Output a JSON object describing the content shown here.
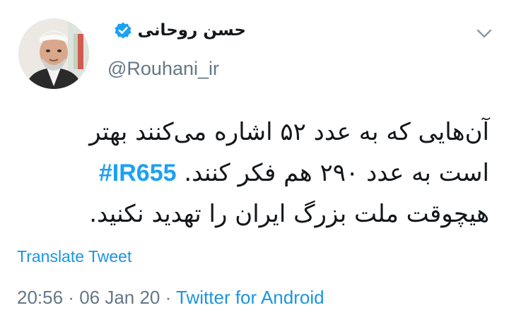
{
  "user": {
    "display_name": "حسن روحانی",
    "handle": "@Rouhani_ir",
    "verified": true,
    "avatar_icon": "profile-photo"
  },
  "tweet": {
    "lines": [
      {
        "text": "آن‌هایی که به عدد ۵۲ اشاره می‌کنند بهتر"
      },
      {
        "text": "است به عدد ۲۹۰ هم فکر کنند.",
        "hashtag": "#IR655"
      },
      {
        "text": "هیچوقت ملت بزرگ ایران را تهدید نکنید."
      }
    ]
  },
  "actions": {
    "translate_label": "Translate Tweet",
    "menu_icon": "chevron-down-icon"
  },
  "meta": {
    "time": "20:56",
    "separator1": " · ",
    "date": "06 Jan 20",
    "separator2": " · ",
    "source": "Twitter for Android"
  },
  "colors": {
    "link": "#1b95e0",
    "hashtag": "#1da1f2",
    "text": "#14171a",
    "secondary": "#657786",
    "verified": "#1da1f2"
  }
}
